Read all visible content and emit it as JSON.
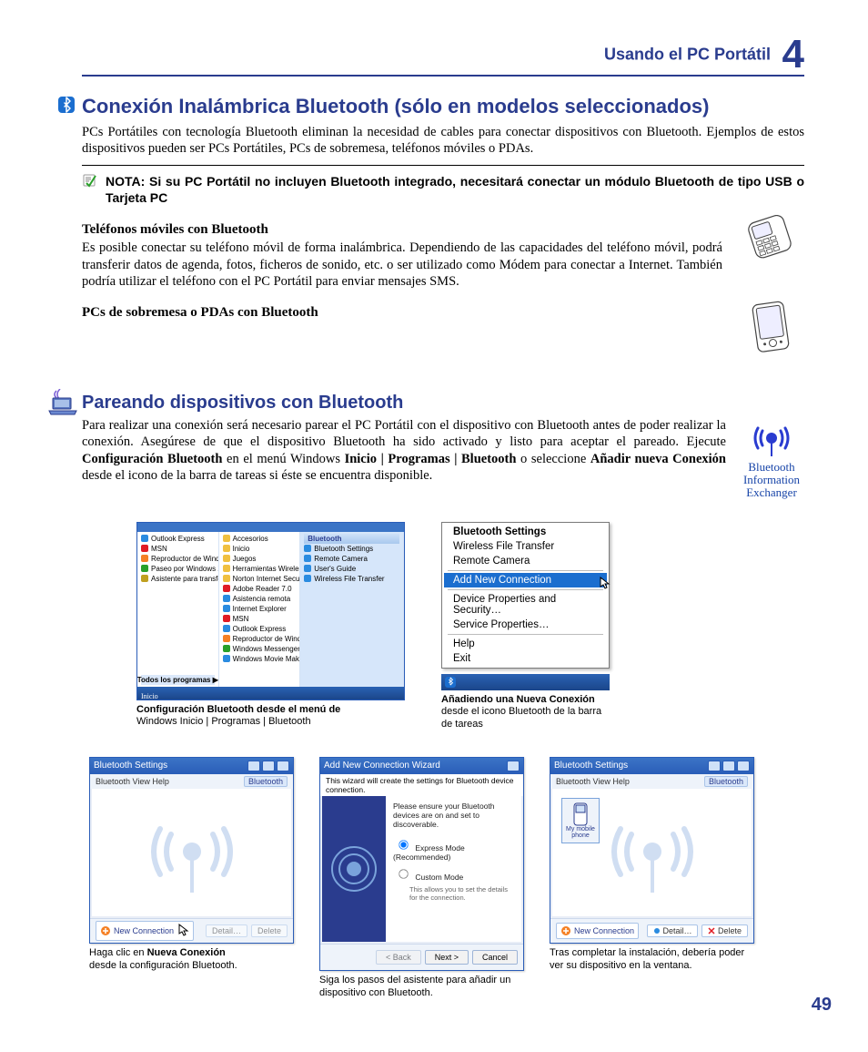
{
  "header": {
    "title": "Usando el PC Portátil",
    "chapter": "4"
  },
  "section1": {
    "heading": "Conexión Inalámbrica Bluetooth (sólo en modelos seleccionados)",
    "intro": "PCs Portátiles con tecnología Bluetooth eliminan la necesidad de cables para conectar dispositivos con Bluetooth. Ejemplos de estos dispositivos pueden ser PCs Portátiles, PCs de sobremesa, teléfonos móviles o PDAs.",
    "note": "NOTA: Si su PC Portátil no incluyen Bluetooth integrado, necesitará conectar un módulo Bluetooth de tipo USB o Tarjeta PC",
    "sub1_title": "Teléfonos móviles con Bluetooth",
    "sub1_text": "Es posible conectar su teléfono móvil de forma inalámbrica. Dependiendo de las capacidades del teléfono móvil, podrá transferir datos de agenda, fotos, ficheros de sonido, etc. o ser utilizado como Módem para conectar a Internet. También podría utilizar el teléfono con el PC Portátil para enviar mensajes SMS.",
    "sub2_title": "PCs de sobremesa o PDAs con Bluetooth"
  },
  "section2": {
    "heading": "Pareando dispositivos con Bluetooth",
    "text_parts": {
      "p1": "Para realizar una conexión será necesario parear el PC Portátil con el dispositivo con Bluetooth antes de poder realizar la conexión. Asegúrese de que el dispositivo Bluetooth ha sido activado y listo para aceptar el pareado. Ejecute ",
      "b1": "Configuración Bluetooth",
      "p2": " en el menú Windows ",
      "b2": "Inicio | Programas | Bluetooth",
      "p3": " o seleccione ",
      "b3": "Añadir nueva Conexión",
      "p4": " desde el icono de la barra de tareas si éste se encuentra disponible."
    },
    "antenna_label": "Bluetooth Information Exchanger"
  },
  "startmenu": {
    "left": [
      {
        "label": "Outlook Express",
        "color": "#2a8be0"
      },
      {
        "label": "MSN",
        "color": "#e01b24"
      },
      {
        "label": "Reproductor de Windows Media",
        "color": "#f58025"
      },
      {
        "label": "Paseo por Windows XP",
        "color": "#2aa02a"
      },
      {
        "label": "Asistente para transferencia de archivos y configuraciones",
        "color": "#c0a020"
      }
    ],
    "left_footer": "Todos los programas ▶",
    "mid": [
      {
        "label": "Accesorios",
        "color": "#f0c040"
      },
      {
        "label": "Inicio",
        "color": "#f0c040"
      },
      {
        "label": "Juegos",
        "color": "#f0c040"
      },
      {
        "label": "Herramientas Wireless Utility Platform",
        "color": "#f0c040"
      },
      {
        "label": "Norton Internet Security",
        "color": "#f0c040"
      },
      {
        "label": "Adobe Reader 7.0",
        "color": "#e01b24"
      },
      {
        "label": "Asistencia remota",
        "color": "#2a8be0"
      },
      {
        "label": "Internet Explorer",
        "color": "#2a8be0"
      },
      {
        "label": "MSN",
        "color": "#e01b24"
      },
      {
        "label": "Outlook Express",
        "color": "#2a8be0"
      },
      {
        "label": "Reproductor de Windows Media",
        "color": "#f58025"
      },
      {
        "label": "Windows Messenger",
        "color": "#2aa02a"
      },
      {
        "label": "Windows Movie Maker",
        "color": "#2a8be0"
      }
    ],
    "right_header": "Bluetooth",
    "right": [
      {
        "label": "Bluetooth Settings",
        "color": "#2a8be0"
      },
      {
        "label": "Remote Camera",
        "color": "#2a8be0"
      },
      {
        "label": "User's Guide",
        "color": "#2a8be0"
      },
      {
        "label": "Wireless File Transfer",
        "color": "#2a8be0"
      }
    ],
    "start_label": "Inicio",
    "caption_bold": "Configuración Bluetooth desde el menú de",
    "caption_rest": "Windows Inicio | Programas | Bluetooth"
  },
  "context_menu": {
    "items": [
      {
        "label": "Bluetooth Settings",
        "title": true
      },
      {
        "label": "Wireless File Transfer"
      },
      {
        "label": "Remote Camera"
      },
      {
        "sep": true
      },
      {
        "label": "Add New Connection",
        "selected": true
      },
      {
        "sep": true
      },
      {
        "label": "Device Properties and Security…"
      },
      {
        "label": "Service Properties…"
      },
      {
        "sep": true
      },
      {
        "label": "Help"
      },
      {
        "label": "Exit"
      }
    ],
    "caption_bold": "Añadiendo una Nueva Conexión",
    "caption_rest": " desde el icono Bluetooth de la barra de tareas"
  },
  "win1": {
    "title": "Bluetooth Settings",
    "menu": "Bluetooth   View   Help",
    "bt_tag": "Bluetooth",
    "newconn": "New Connection",
    "btn1": "Detail…",
    "btn2": "Delete",
    "caption_pre": "Haga clic en ",
    "caption_bold": "Nueva Conexión",
    "caption_post": " desde la configuración Bluetooth."
  },
  "win2": {
    "title": "Add New Connection Wizard",
    "subtitle": "This wizard will create the settings for Bluetooth device connection.",
    "hint": "Please ensure your Bluetooth devices are on and set to discoverable.",
    "opt1": "Express Mode (Recommended)",
    "opt2": "Custom Mode",
    "opt2_hint": "This allows you to set the details for the connection.",
    "btn_back": "< Back",
    "btn_next": "Next >",
    "btn_cancel": "Cancel",
    "caption": "Siga los pasos del asistente para añadir un dispositivo con Bluetooth."
  },
  "win3": {
    "title": "Bluetooth Settings",
    "menu": "Bluetooth   View   Help",
    "bt_tag": "Bluetooth",
    "paired_label": "My mobile phone",
    "newconn": "New Connection",
    "btn1": "Detail…",
    "btn2": "Delete",
    "caption": "Tras completar la instalación, debería poder ver su dispositivo en la ventana."
  },
  "page_number": "49"
}
